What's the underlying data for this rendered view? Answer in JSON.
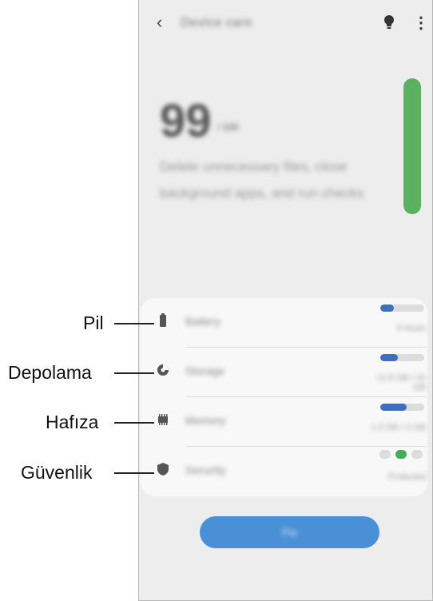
{
  "app": {
    "title": "Device care",
    "back_icon": "arrow-left-icon",
    "bulb_icon": "lightbulb-icon",
    "more_icon": "more-vertical-icon"
  },
  "score": {
    "value": "99",
    "max": "/ 100",
    "description": "Delete unnecessary files, close background apps, and run checks"
  },
  "gauge": {
    "level": 0.99,
    "color": "#5cb161"
  },
  "items": [
    {
      "key": "battery",
      "label": "Battery",
      "value": "9 hours",
      "level": 0.3,
      "icon": "battery-icon"
    },
    {
      "key": "storage",
      "label": "Storage",
      "value": "12.8 GB / 32 GB",
      "level": 0.4,
      "icon": "storage-pie-icon"
    },
    {
      "key": "memory",
      "label": "Memory",
      "value": "1.6 GB / 3 GB",
      "level": 0.6,
      "icon": "memory-chip-icon"
    },
    {
      "key": "security",
      "label": "Security",
      "value": "Protected",
      "status": "good",
      "icon": "shield-icon"
    }
  ],
  "fix_button": {
    "label": "Fix"
  },
  "callouts": [
    "Pil",
    "Depolama",
    "Hafıza",
    "Güvenlik"
  ],
  "colors": {
    "accent": "#3c6fc4",
    "ok": "#3fae57",
    "button": "#4a90d6"
  }
}
